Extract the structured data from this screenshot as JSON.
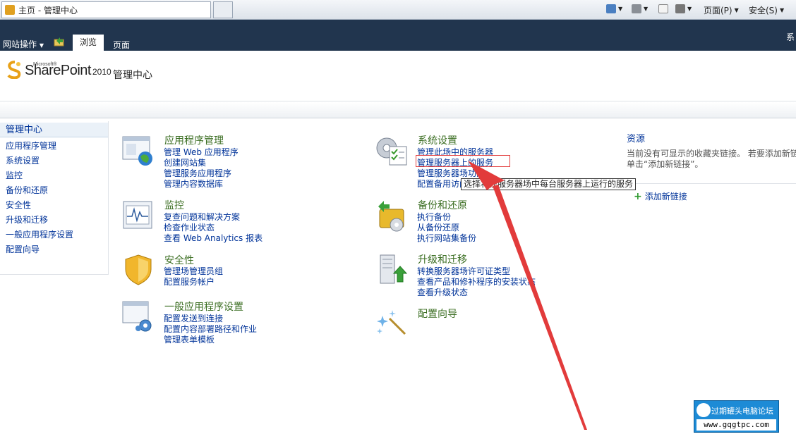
{
  "browser": {
    "tab_title": "主页 - 管理中心",
    "commands": {
      "page_menu": "页面(P)",
      "safety_menu": "安全(S)"
    }
  },
  "ribbon": {
    "site_actions": "网站操作",
    "tab_browse": "浏览",
    "tab_page": "页面",
    "right_text": "系"
  },
  "header": {
    "logo_ms": "Microsoft®",
    "logo_text": "SharePoint",
    "logo_year": "2010",
    "site_title": "管理中心"
  },
  "leftnav": {
    "title": "管理中心",
    "items": [
      "应用程序管理",
      "系统设置",
      "监控",
      "备份和还原",
      "安全性",
      "升级和迁移",
      "一般应用程序设置",
      "配置向导"
    ]
  },
  "sections": {
    "app_mgmt": {
      "title": "应用程序管理",
      "links": [
        "管理 Web 应用程序",
        "创建网站集",
        "管理服务应用程序",
        "管理内容数据库"
      ]
    },
    "monitoring": {
      "title": "监控",
      "links": [
        "复查问题和解决方案",
        "检查作业状态",
        "查看 Web Analytics 报表"
      ]
    },
    "security": {
      "title": "安全性",
      "links": [
        "管理场管理员组",
        "配置服务帐户"
      ]
    },
    "general": {
      "title": "一般应用程序设置",
      "links": [
        "配置发送到连接",
        "配置内容部署路径和作业",
        "管理表单模板"
      ]
    },
    "system": {
      "title": "系统设置",
      "links": [
        "管理此场中的服务器",
        "管理服务器上的服务",
        "管理服务器场功能",
        "配置备用访问映射"
      ]
    },
    "backup": {
      "title": "备份和还原",
      "links": [
        "执行备份",
        "从备份还原",
        "执行网站集备份"
      ]
    },
    "upgrade": {
      "title": "升级和迁移",
      "links": [
        "转换服务器场许可证类型",
        "查看产品和修补程序的安装状态",
        "查看升级状态"
      ]
    },
    "wizard": {
      "title": "配置向导"
    }
  },
  "resources": {
    "title": "资源",
    "text_line1": "当前没有可显示的收藏夹链接。 若要添加新链",
    "text_line2": "单击“添加新链接”。",
    "add_link": "添加新链接"
  },
  "tooltip": "选择将在服务器场中每台服务器上运行的服务",
  "watermark": {
    "title": "过期罐头电脑论坛",
    "url": "www.gqgtpc.com"
  }
}
